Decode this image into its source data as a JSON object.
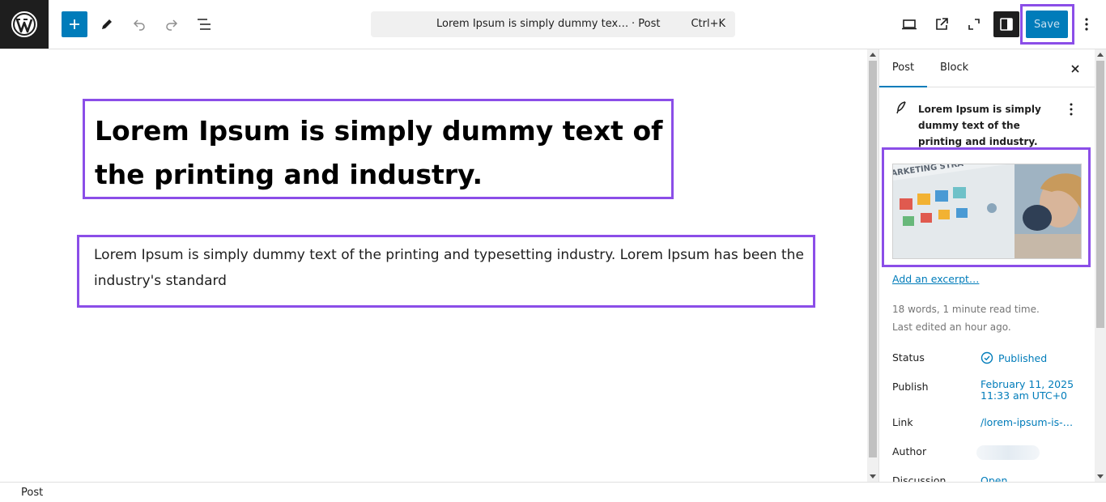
{
  "toolbar": {
    "document_title": "Lorem Ipsum is simply dummy text of …",
    "document_type": "· Post",
    "command_shortcut": "Ctrl+K",
    "save_label": "Save"
  },
  "editor": {
    "title": "Lorem Ipsum is simply dummy text of the printing and industry.",
    "paragraph": "Lorem Ipsum is simply dummy text of the printing and typesetting industry. Lorem Ipsum has been the industry's standard"
  },
  "sidebar": {
    "tabs": [
      {
        "label": "Post",
        "active": true
      },
      {
        "label": "Block",
        "active": false
      }
    ],
    "summary_title": "Lorem Ipsum is simply dummy text of the printing and industry.",
    "featured_image_text": "ARKETING STRA",
    "excerpt_link": "Add an excerpt…",
    "word_count": "18 words, 1 minute read time.",
    "last_edited": "Last edited an hour ago.",
    "rows": [
      {
        "label": "Status",
        "value": "Published"
      },
      {
        "label": "Publish",
        "value": "February 11, 2025",
        "value2": "11:33 am UTC+0"
      },
      {
        "label": "Link",
        "value": "/lorem-ipsum-is-…"
      },
      {
        "label": "Author",
        "value": ""
      },
      {
        "label": "Discussion",
        "value": "Open"
      }
    ]
  },
  "footer": {
    "breadcrumb": "Post"
  },
  "colors": {
    "accent": "#007cba",
    "highlight": "#8b4ee8",
    "dark": "#1e1e1e"
  }
}
